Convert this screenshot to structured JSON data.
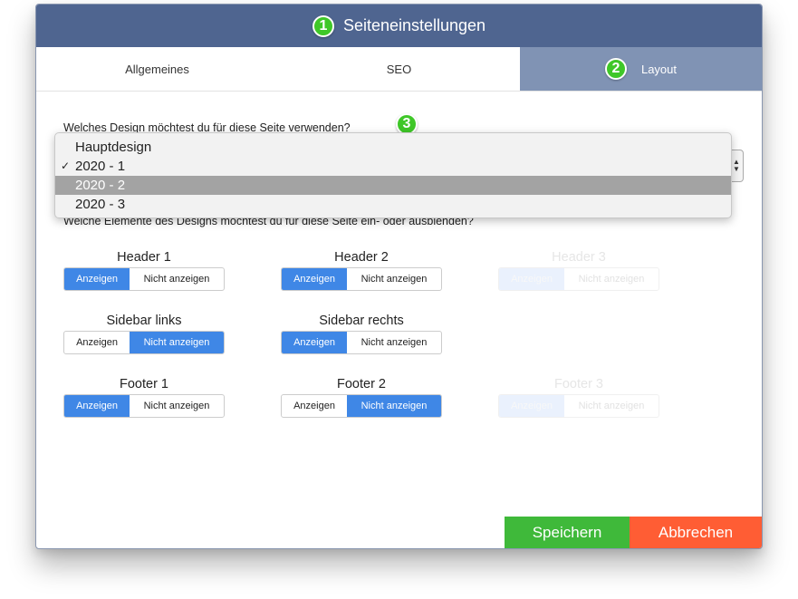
{
  "dialog": {
    "title": "Seiteneinstellungen",
    "title_badge": "1"
  },
  "tabs": [
    {
      "label": "Allgemeines"
    },
    {
      "label": "SEO"
    },
    {
      "label": "Layout",
      "badge": "2",
      "active": true
    }
  ],
  "design_question": {
    "label": "Welches Design möchtest du für diese Seite verwenden?",
    "badge": "3"
  },
  "design_dropdown": {
    "options": [
      "Hauptdesign",
      "2020 - 1",
      "2020 - 2",
      "2020 - 3"
    ],
    "checked": "2020 - 1",
    "highlighted": "2020 - 2",
    "check_mark": "✓",
    "arrows": [
      "▲",
      "▼"
    ]
  },
  "elements_question": {
    "label": "Welche Elemente des Designs möchtest du für diese Seite ein- oder ausblenden?"
  },
  "toggle_labels": {
    "show": "Anzeigen",
    "hide": "Nicht anzeigen"
  },
  "elements": [
    {
      "label": "Header 1",
      "selected": "show"
    },
    {
      "label": "Header 2",
      "selected": "show"
    },
    {
      "label": "Header 3",
      "selected": "show",
      "disabled": true
    },
    {
      "label": "Sidebar links",
      "selected": "hide"
    },
    {
      "label": "Sidebar rechts",
      "selected": "show"
    },
    {
      "label": "Footer 1",
      "selected": "show"
    },
    {
      "label": "Footer 2",
      "selected": "hide"
    },
    {
      "label": "Footer 3",
      "selected": "show",
      "disabled": true
    }
  ],
  "buttons": {
    "save": "Speichern",
    "cancel": "Abbrechen"
  },
  "colors": {
    "header": "#4f6590",
    "active_tab": "#8093b4",
    "badge": "#3fc728",
    "toggle_selected": "#3f87e6",
    "save": "#3fb93a",
    "cancel": "#ff5d34"
  }
}
